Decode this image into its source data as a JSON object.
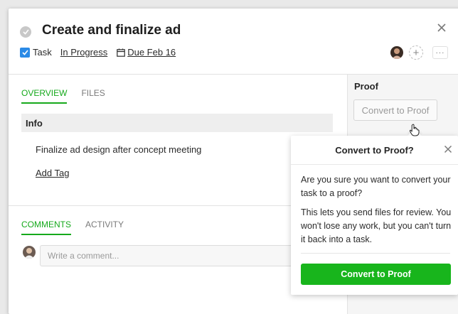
{
  "task": {
    "title": "Create and finalize ad",
    "type_label": "Task",
    "status": "In Progress",
    "due": "Due Feb 16"
  },
  "tabs_top": [
    {
      "label": "OVERVIEW",
      "active": true
    },
    {
      "label": "FILES",
      "active": false
    }
  ],
  "overview": {
    "section_header": "Info",
    "description": "Finalize ad design after concept meeting",
    "add_tag": "Add Tag"
  },
  "tabs_bottom": [
    {
      "label": "COMMENTS",
      "active": true
    },
    {
      "label": "ACTIVITY",
      "active": false
    }
  ],
  "comment": {
    "placeholder": "Write a comment..."
  },
  "proof_panel": {
    "label": "Proof",
    "button": "Convert to Proof"
  },
  "popover": {
    "title": "Convert to Proof?",
    "paragraph1": "Are you sure you want to convert your task to a proof?",
    "paragraph2": "This lets you send files for review. You won't lose any work, but you can't turn it back into a task.",
    "confirm": "Convert to Proof"
  },
  "header_actions": {
    "more": "···",
    "add": "+"
  },
  "colors": {
    "accent_green": "#16a91c",
    "task_blue": "#2b8ae6"
  }
}
